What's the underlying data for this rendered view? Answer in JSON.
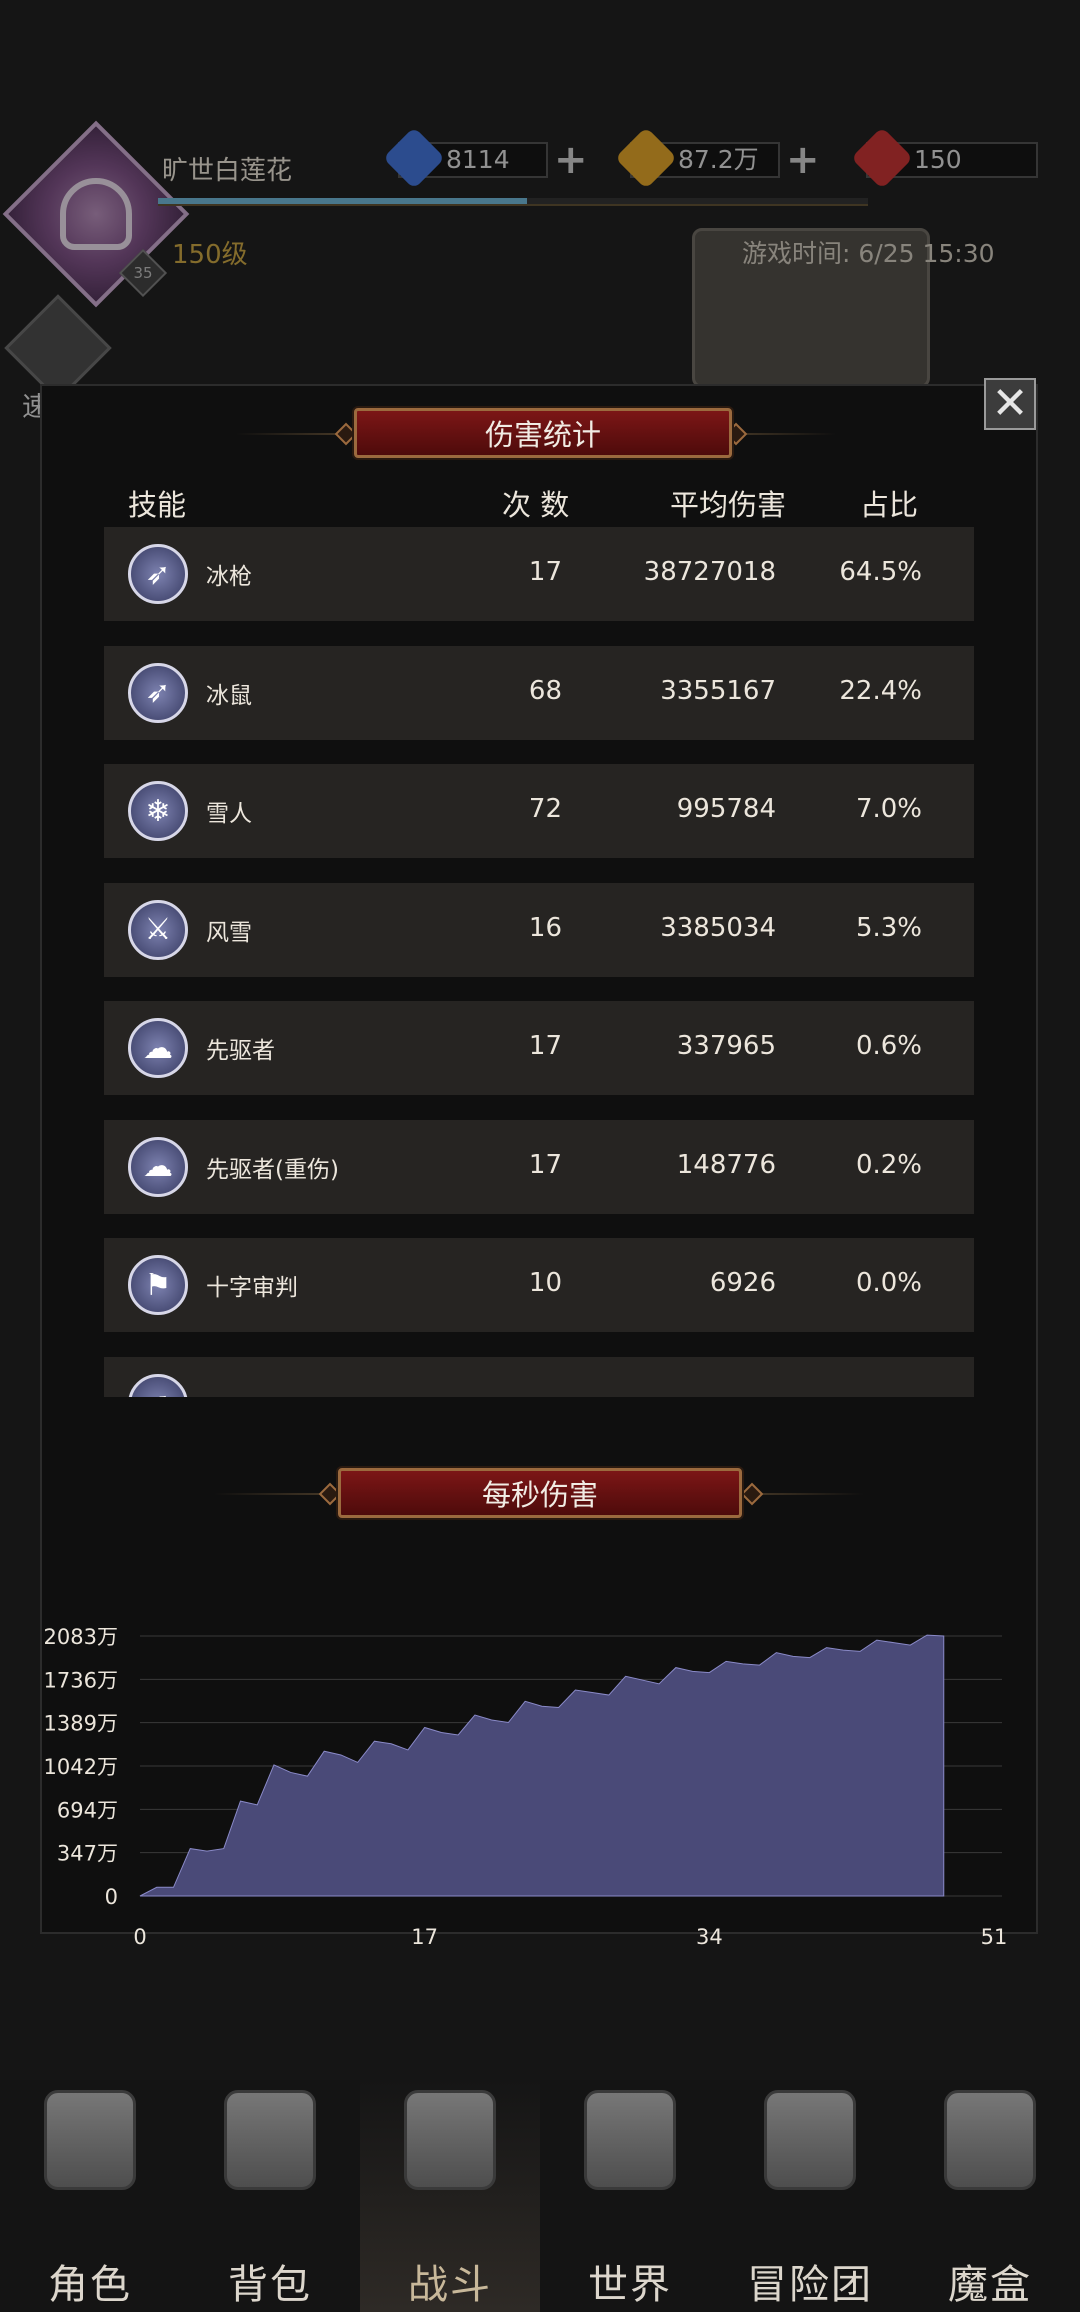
{
  "header": {
    "player_name": "旷世白莲花",
    "level": "150级",
    "avatar_badge": "35",
    "exp_fill": 0.52,
    "resources": [
      {
        "name": "blue-gem",
        "value": "8114",
        "color": "#3a6fd8"
      },
      {
        "name": "gold-gem",
        "value": "87.2万",
        "color": "#e0a020"
      },
      {
        "name": "red-gem",
        "value": "150",
        "color": "#c42a2a"
      }
    ],
    "game_time": "游戏时间: 6/25 15:30",
    "quick_battle": "速 战"
  },
  "modal": {
    "damage_title": "伤害统计",
    "columns": {
      "skill": "技能",
      "count": "次 数",
      "avg": "平均伤害",
      "pct": "占比"
    },
    "rows": [
      {
        "icon": "ice-spear-icon",
        "glyph": "➶",
        "name": "冰枪",
        "count": "17",
        "avg": "38727018",
        "pct": "64.5%"
      },
      {
        "icon": "ice-spear-icon",
        "glyph": "➶",
        "name": "冰鼠",
        "count": "68",
        "avg": "3355167",
        "pct": "22.4%"
      },
      {
        "icon": "snowflake-icon",
        "glyph": "❄",
        "name": "雪人",
        "count": "72",
        "avg": "995784",
        "pct": "7.0%"
      },
      {
        "icon": "sword-icon",
        "glyph": "⚔",
        "name": "风雪",
        "count": "16",
        "avg": "3385034",
        "pct": "5.3%"
      },
      {
        "icon": "cloud-burst-icon",
        "glyph": "☁",
        "name": "先驱者",
        "count": "17",
        "avg": "337965",
        "pct": "0.6%"
      },
      {
        "icon": "cloud-burst-icon",
        "glyph": "☁",
        "name": "先驱者(重伤)",
        "count": "17",
        "avg": "148776",
        "pct": "0.2%"
      },
      {
        "icon": "banner-icon",
        "glyph": "⚑",
        "name": "十字审判",
        "count": "10",
        "avg": "6926",
        "pct": "0.0%"
      },
      {
        "icon": "ice-spear-icon",
        "glyph": "➶",
        "name": "",
        "count": "",
        "avg": "",
        "pct": ""
      }
    ],
    "dps_title": "每秒伤害",
    "close": "✕"
  },
  "chart_data": {
    "type": "area",
    "title": "每秒伤害",
    "y_ticks": [
      "2083万",
      "1736万",
      "1389万",
      "1042万",
      "694万",
      "347万",
      "0"
    ],
    "x_ticks": [
      "0",
      "17",
      "34",
      "51"
    ],
    "ylim": [
      0,
      2083
    ],
    "xlim": [
      0,
      51
    ],
    "color": "#4a4a78",
    "x": [
      0,
      1,
      2,
      3,
      4,
      5,
      6,
      7,
      8,
      9,
      10,
      11,
      12,
      13,
      14,
      15,
      16,
      17,
      18,
      19,
      20,
      21,
      22,
      23,
      24,
      25,
      26,
      27,
      28,
      29,
      30,
      31,
      32,
      33,
      34,
      35,
      36,
      37,
      38,
      39,
      40,
      41,
      42,
      43,
      44,
      45,
      46,
      47,
      48
    ],
    "values": [
      0,
      70,
      70,
      380,
      360,
      380,
      760,
      730,
      1050,
      990,
      960,
      1160,
      1130,
      1070,
      1240,
      1220,
      1170,
      1350,
      1310,
      1290,
      1450,
      1410,
      1390,
      1560,
      1520,
      1510,
      1650,
      1630,
      1610,
      1760,
      1730,
      1700,
      1830,
      1800,
      1790,
      1880,
      1860,
      1850,
      1950,
      1920,
      1910,
      1990,
      1970,
      1960,
      2050,
      2030,
      2010,
      2090,
      2083
    ]
  },
  "nav": [
    {
      "label": "角色",
      "icon": "helmet-icon"
    },
    {
      "label": "背包",
      "icon": "backpack-icon"
    },
    {
      "label": "战斗",
      "icon": "swords-shield-icon",
      "active": true
    },
    {
      "label": "世界",
      "icon": "map-scroll-icon"
    },
    {
      "label": "冒险团",
      "icon": "castle-icon"
    },
    {
      "label": "魔盒",
      "icon": "cube-icon"
    }
  ]
}
